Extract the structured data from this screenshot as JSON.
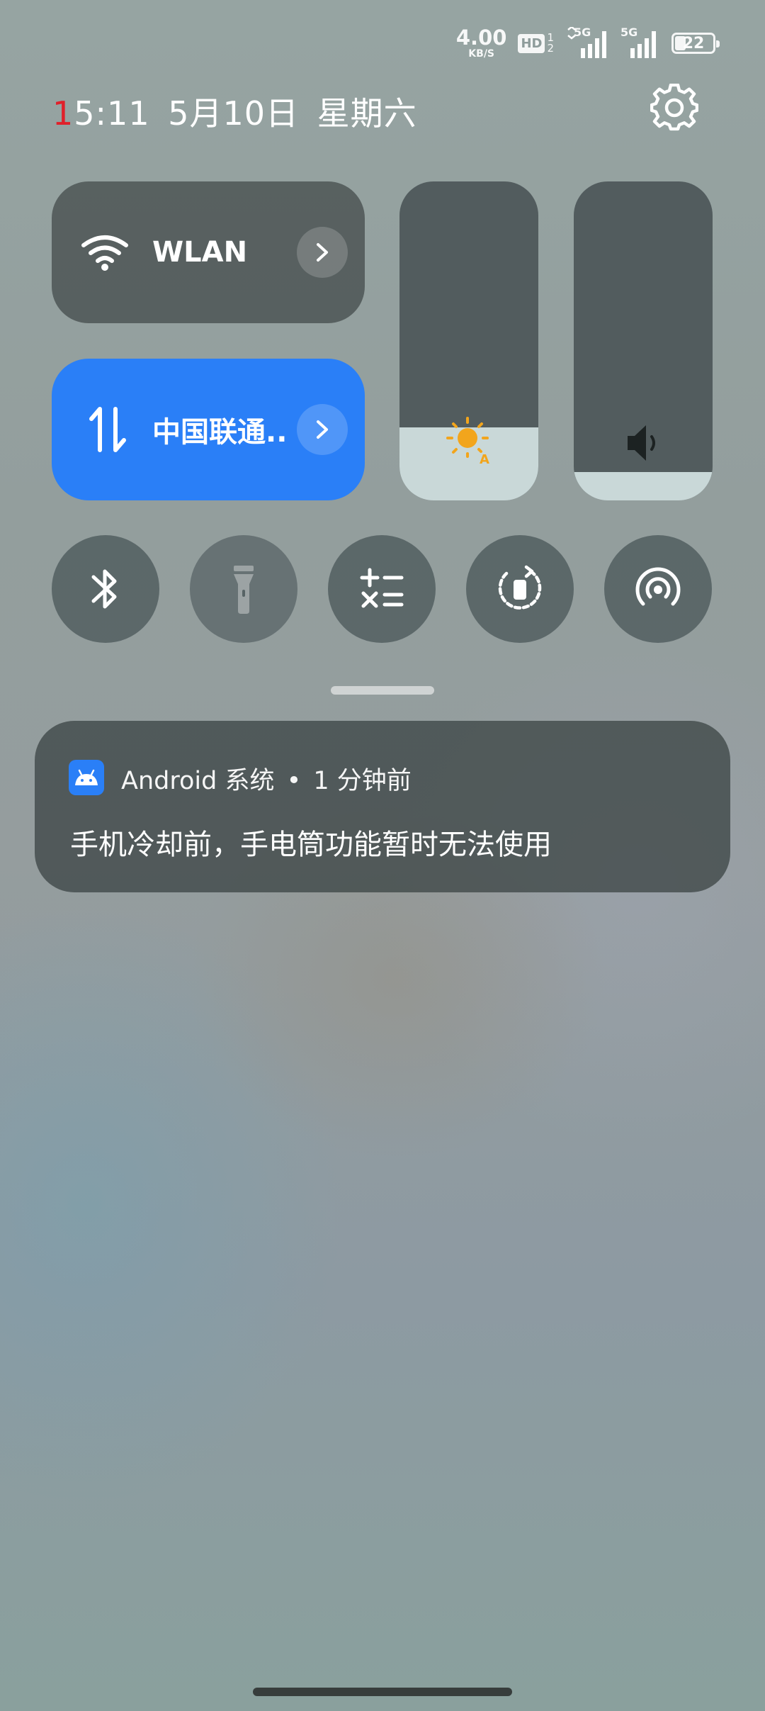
{
  "status_bar": {
    "net_speed_value": "4.00",
    "net_speed_unit": "KB/S",
    "hd_label": "HD",
    "hd_slot_1": "1",
    "hd_slot_2": "2",
    "sim1_label": "5G",
    "sim2_label": "5G",
    "battery_level": "22"
  },
  "header": {
    "time_first_digit": "1",
    "time_rest": "5:11",
    "date": "5月10日",
    "weekday": "星期六"
  },
  "tiles": {
    "wlan_label": "WLAN",
    "mobile_label": "中国联通..",
    "brightness_level_percent": 23,
    "volume_level_percent": 9
  },
  "icons": {
    "settings": "gear-icon",
    "wlan": "wifi-icon",
    "mobile": "mobile-data-icon",
    "brightness": "auto-brightness-icon",
    "volume": "speaker-icon",
    "bluetooth": "bluetooth-icon",
    "flashlight": "flashlight-icon",
    "calculator": "calculator-icon",
    "rotation": "auto-rotate-icon",
    "hotspot": "hotspot-icon"
  },
  "notification": {
    "app_name": "Android 系统",
    "separator": "•",
    "time_ago": "1 分钟前",
    "message": "手机冷却前，手电筒功能暂时无法使用"
  },
  "colors": {
    "accent_blue": "#2a7ff7",
    "time_red": "#e0202a",
    "brightness_sun": "#f2a51c"
  }
}
